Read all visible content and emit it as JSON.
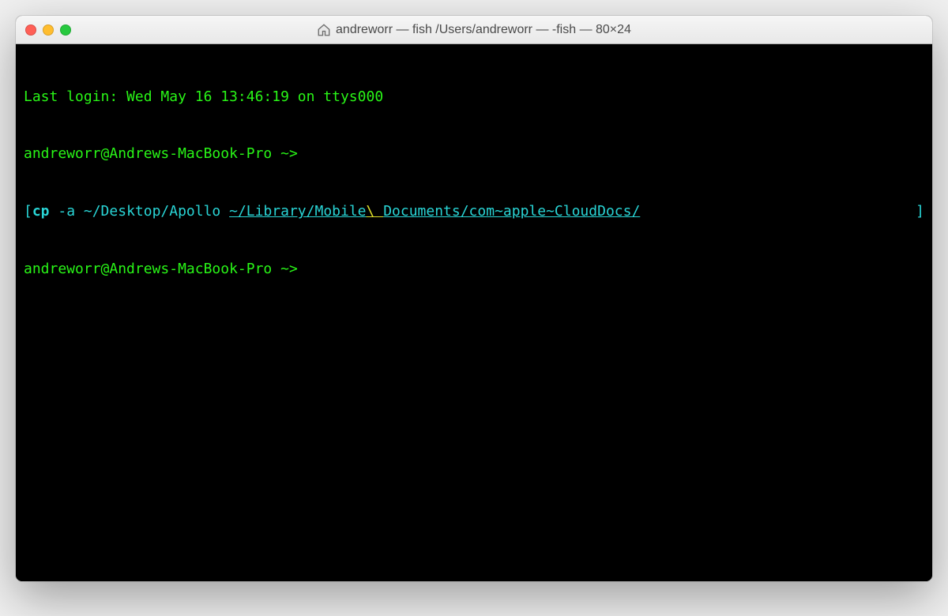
{
  "window": {
    "title": "andreworr — fish  /Users/andreworr — -fish — 80×24"
  },
  "terminal": {
    "last_login": "Last login: Wed May 16 13:46:19 on ttys000",
    "prompt1": "andreworr@Andrews-MacBook-Pro ~>",
    "bracket_open": "[",
    "cmd_name": "cp",
    "cmd_args_plain": " -a ~/Desktop/Apollo ",
    "cmd_dest_prefix": "~/Library/Mobile",
    "cmd_dest_escape": "\\ ",
    "cmd_dest_suffix": "Documents/com~apple~CloudDocs/",
    "bracket_close": "]",
    "prompt2": "andreworr@Andrews-MacBook-Pro ~>"
  },
  "colors": {
    "green": "#29f617",
    "cyan": "#29d5d6",
    "yellow": "#e0e02a",
    "background": "#000000"
  }
}
